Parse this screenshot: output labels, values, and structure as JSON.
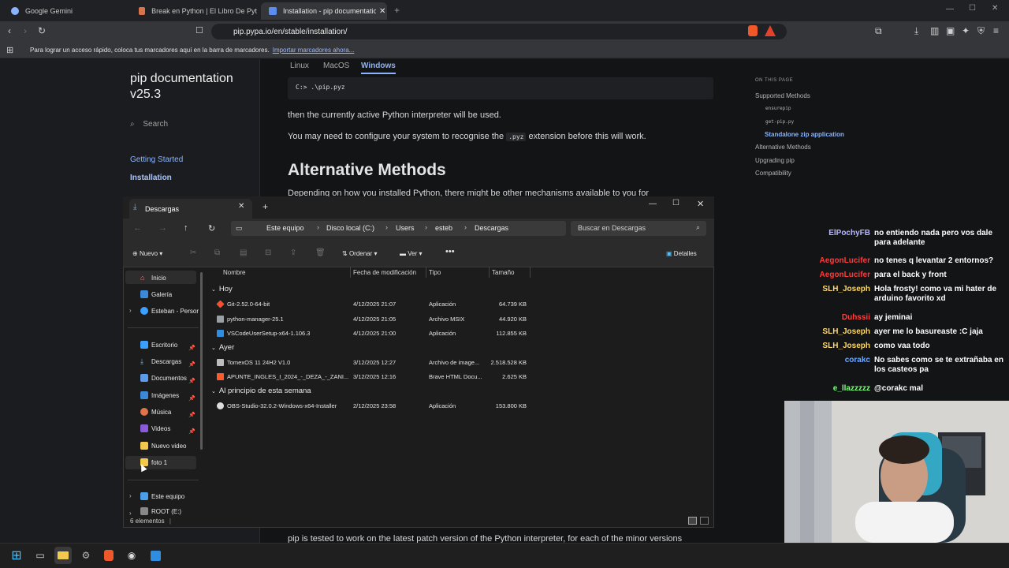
{
  "browser": {
    "tabs": [
      {
        "label": "Google Gemini",
        "icon": "gemini-icon"
      },
      {
        "label": "Break en Python | El Libro De Pyt",
        "icon": "book-icon"
      },
      {
        "label": "Installation - pip documentation",
        "icon": "doc-icon"
      }
    ],
    "url": "pip.pypa.io/en/stable/installation/",
    "bookmarks_text": "Para lograr un acceso rápido, coloca tus marcadores aquí en la barra de marcadores.",
    "bookmarks_link": "Importar marcadores ahora..."
  },
  "docs": {
    "title_line1": "pip documentation",
    "title_line2": "v25.3",
    "search_placeholder": "Search",
    "nav": [
      "Getting Started",
      "Installation"
    ],
    "os_tabs": [
      "Linux",
      "MacOS",
      "Windows"
    ],
    "code": "C:> .\\pip.pyz",
    "para1": "then the currently active Python interpreter will be used.",
    "para2_a": "You may need to configure your system to recognise the",
    "para2_code": ".pyz",
    "para2_b": "extension before this will work.",
    "heading": "Alternative Methods",
    "para3": "Depending on how you installed Python, there might be other mechanisms available to you for",
    "para_bottom": "pip is tested to work on the latest patch version of the Python interpreter, for each of the minor versions",
    "toc_head": "ON THIS PAGE",
    "toc": [
      {
        "label": "Supported Methods"
      },
      {
        "label": "ensurepip"
      },
      {
        "label": "get-pip.py"
      },
      {
        "label": "Standalone zip application"
      },
      {
        "label": "Alternative Methods"
      },
      {
        "label": "Upgrading pip"
      },
      {
        "label": "Compatibility"
      }
    ]
  },
  "chat": [
    {
      "user": "ElPochyFB",
      "msg": "no entiendo nada pero vos dale para adelante",
      "color": "#b8b8ff"
    },
    {
      "user": "AegonLucifer",
      "msg": "no tenes q levantar 2 entornos?",
      "color": "#ff3b3b"
    },
    {
      "user": "AegonLucifer",
      "msg": "para el back y front",
      "color": "#ff3b3b"
    },
    {
      "user": "SLH_Joseph",
      "msg": "Hola frosty! como va mi hater de arduino favorito xd",
      "color": "#ffd966"
    },
    {
      "user": "Duhssii",
      "msg": "ay jeminai",
      "color": "#ff4040"
    },
    {
      "user": "SLH_Joseph",
      "msg": "ayer me lo basureaste :C jaja",
      "color": "#ffd966"
    },
    {
      "user": "SLH_Joseph",
      "msg": "como vaa todo",
      "color": "#ffd966"
    },
    {
      "user": "corakc",
      "msg": "No sabes como se te extrañaba en los casteos pa",
      "color": "#6fa8ff"
    },
    {
      "user": "e_llazzzzz",
      "msg": "@corakc mal",
      "color": "#7cff7c"
    }
  ],
  "explorer": {
    "tab_title": "Descargas",
    "breadcrumb": [
      "Este equipo",
      "Disco local (C:)",
      "Users",
      "esteb",
      "Descargas"
    ],
    "search_placeholder": "Buscar en Descargas",
    "cmd": {
      "new": "Nuevo",
      "sort": "Ordenar",
      "view": "Ver",
      "details": "Detalles"
    },
    "columns": [
      "Nombre",
      "Fecha de modificación",
      "Tipo",
      "Tamaño"
    ],
    "nav": [
      {
        "label": "Inicio",
        "icon": "home-icon"
      },
      {
        "label": "Galería",
        "icon": "gallery-icon"
      },
      {
        "label": "Esteban - Persor",
        "icon": "onedrive-icon"
      },
      {
        "label": "Escritorio",
        "icon": "desktop-icon"
      },
      {
        "label": "Descargas",
        "icon": "download-icon"
      },
      {
        "label": "Documentos",
        "icon": "documents-icon"
      },
      {
        "label": "Imágenes",
        "icon": "pictures-icon"
      },
      {
        "label": "Música",
        "icon": "music-icon"
      },
      {
        "label": "Videos",
        "icon": "videos-icon"
      },
      {
        "label": "Nuevo video",
        "icon": "folder-icon"
      },
      {
        "label": "foto 1",
        "icon": "folder-icon"
      },
      {
        "label": "Este equipo",
        "icon": "computer-icon"
      },
      {
        "label": "ROOT (E:)",
        "icon": "drive-icon"
      }
    ],
    "groups": [
      {
        "label": "Hoy",
        "files": [
          {
            "name": "Git-2.52.0-64-bit",
            "date": "4/12/2025 21:07",
            "type": "Aplicación",
            "size": "64.739 KB",
            "color": "#f05133"
          },
          {
            "name": "python-manager-25.1",
            "date": "4/12/2025 21:05",
            "type": "Archivo MSIX",
            "size": "44.920 KB",
            "color": "#9aa0a6"
          },
          {
            "name": "VSCodeUserSetup-x64-1.106.3",
            "date": "4/12/2025 21:00",
            "type": "Aplicación",
            "size": "112.855 KB",
            "color": "#2f8ee0"
          }
        ]
      },
      {
        "label": "Ayer",
        "files": [
          {
            "name": "TomexOS 11 24H2 V1.0",
            "date": "3/12/2025 12:27",
            "type": "Archivo de image...",
            "size": "2.518.528 KB",
            "color": "#bdbdbd"
          },
          {
            "name": "APUNTE_INGLES_I_2024_-_DEZA_-_ZANI...",
            "date": "3/12/2025 12:16",
            "type": "Brave HTML Docu...",
            "size": "2.625 KB",
            "color": "#ff5a2a"
          }
        ]
      },
      {
        "label": "Al principio de esta semana",
        "files": [
          {
            "name": "OBS-Studio-32.0.2-Windows-x64-Installer",
            "date": "2/12/2025 23:58",
            "type": "Aplicación",
            "size": "153.800 KB",
            "color": "#dddddd"
          }
        ]
      }
    ],
    "status": "6 elementos"
  }
}
